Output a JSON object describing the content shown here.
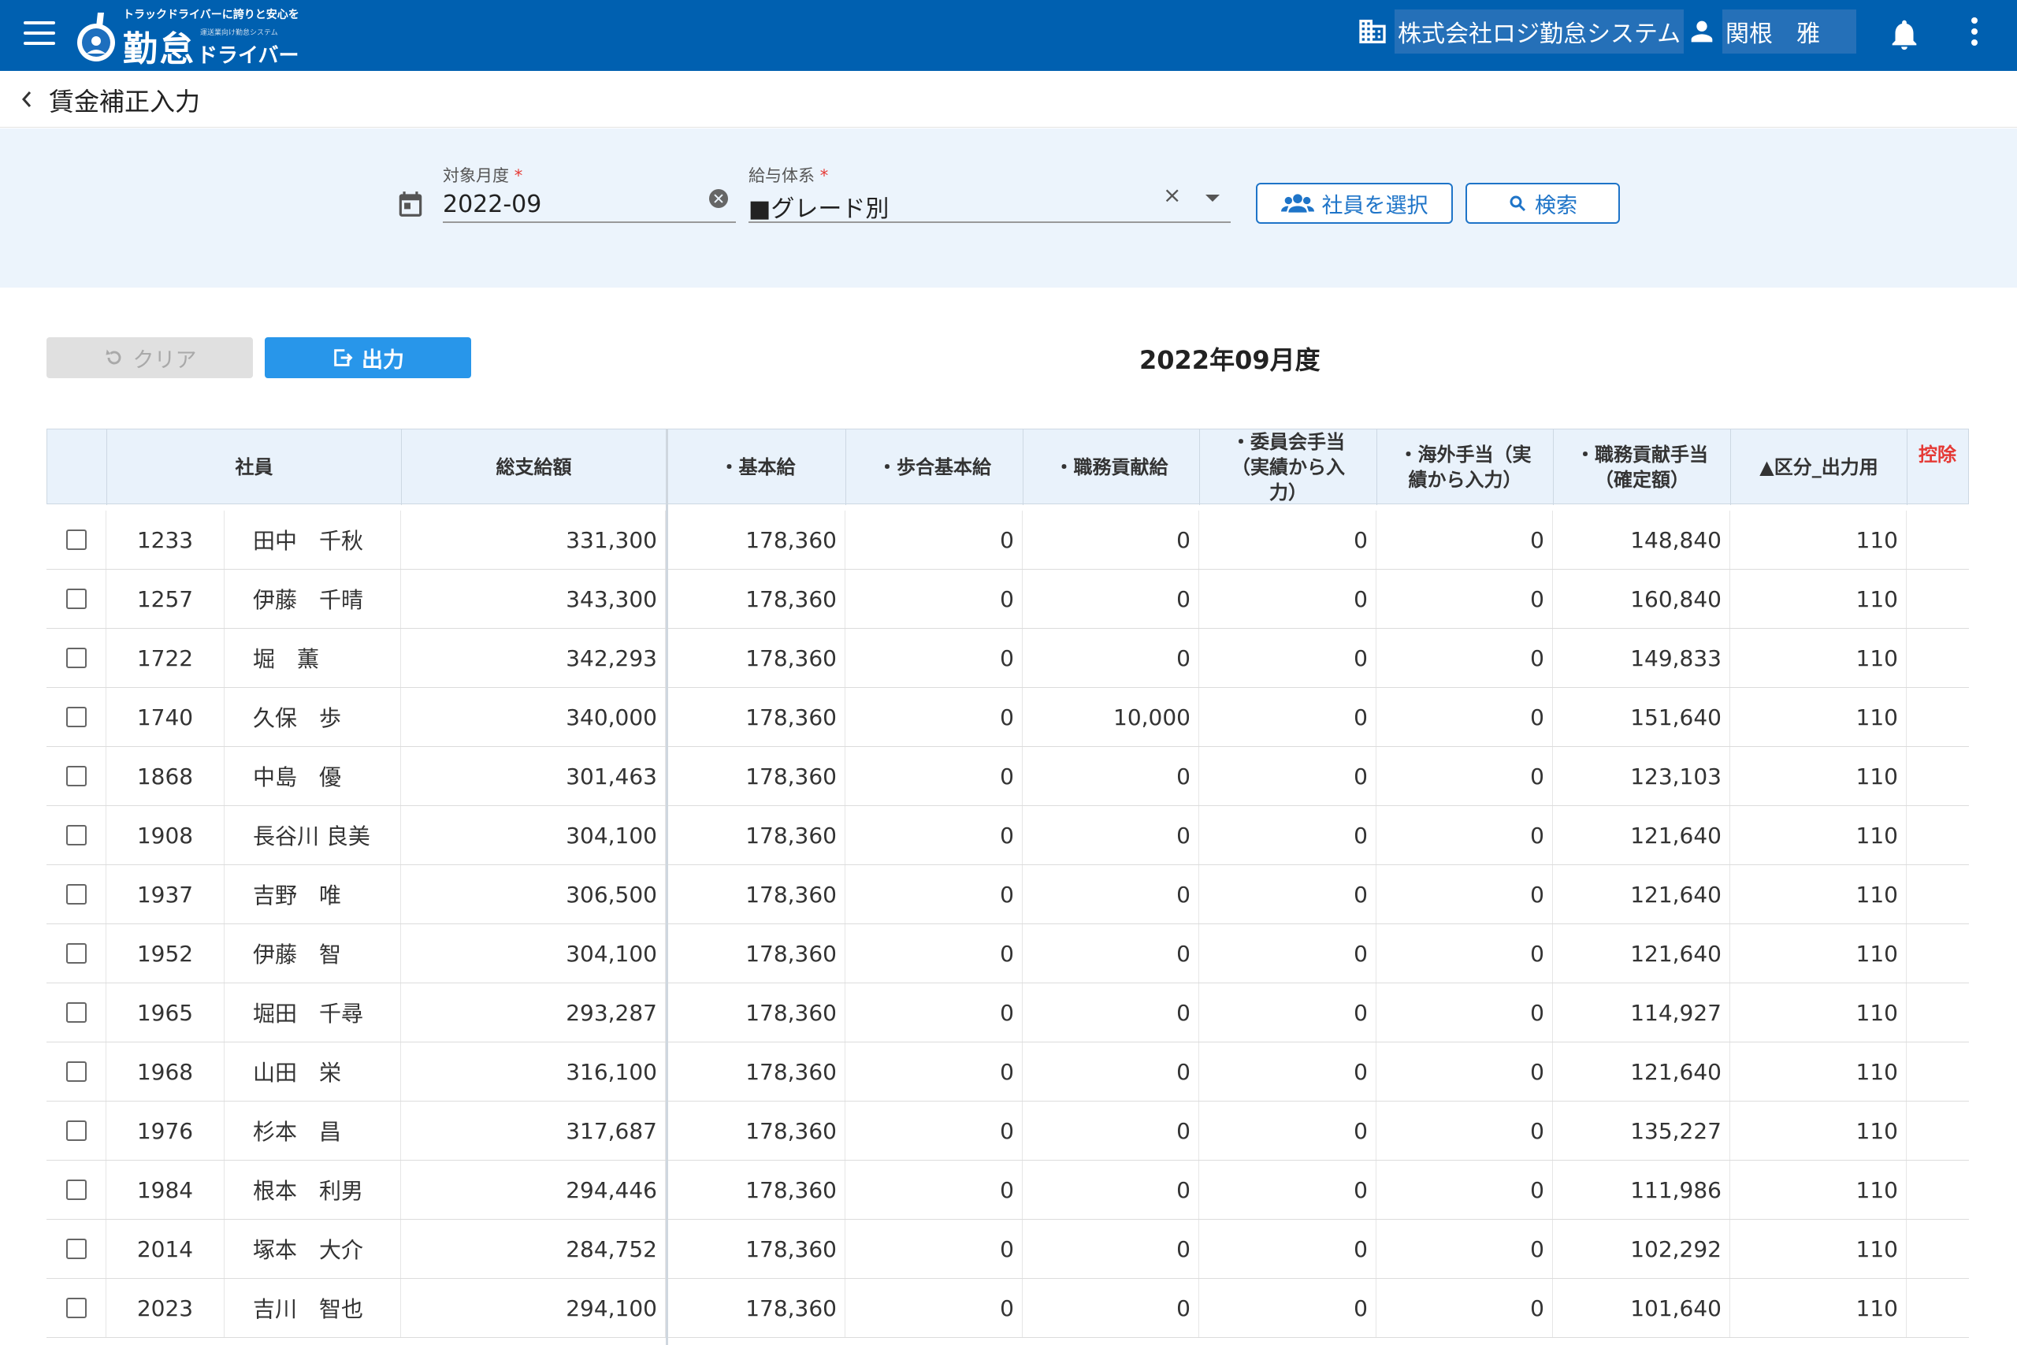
{
  "header": {
    "logo_tagline": "トラックドライバーに誇りと安心を",
    "logo_main": "勤怠",
    "logo_sub_small": "運送業向け勤怠システム",
    "logo_sub": "ドライバー",
    "company": "株式会社ロジ勤怠システム",
    "user": "関根　雅",
    "brand_color": "#0060b0"
  },
  "page": {
    "title": "賃金補正入力"
  },
  "filters": {
    "month_label": "対象月度",
    "month_value": "2022-09",
    "pay_label": "給与体系",
    "pay_value": "■グレード別",
    "required_mark": "*",
    "select_employee": "社員を選択",
    "search": "検索"
  },
  "actions": {
    "clear": "クリア",
    "output": "出力",
    "period": "2022年09月度"
  },
  "table": {
    "headers": {
      "employee": "社員",
      "total": "総支給額",
      "basic": "・基本給",
      "commission": "・歩合基本給",
      "duty": "・職務貢献給",
      "committee": "・委員会手当（実績から入力）",
      "overseas": "・海外手当（実績から入力）",
      "duty_allow": "・職務貢献手当（確定額）",
      "category": "▲区分_出力用",
      "deduction": "控除"
    },
    "rows": [
      {
        "id": "1233",
        "name": "田中　千秋",
        "total": "331,300",
        "basic": "178,360",
        "commission": "0",
        "duty": "0",
        "committee": "0",
        "overseas": "0",
        "duty_allow": "148,840",
        "category": "110"
      },
      {
        "id": "1257",
        "name": "伊藤　千晴",
        "total": "343,300",
        "basic": "178,360",
        "commission": "0",
        "duty": "0",
        "committee": "0",
        "overseas": "0",
        "duty_allow": "160,840",
        "category": "110"
      },
      {
        "id": "1722",
        "name": "堀　薫",
        "total": "342,293",
        "basic": "178,360",
        "commission": "0",
        "duty": "0",
        "committee": "0",
        "overseas": "0",
        "duty_allow": "149,833",
        "category": "110"
      },
      {
        "id": "1740",
        "name": "久保　歩",
        "total": "340,000",
        "basic": "178,360",
        "commission": "0",
        "duty": "10,000",
        "committee": "0",
        "overseas": "0",
        "duty_allow": "151,640",
        "category": "110"
      },
      {
        "id": "1868",
        "name": "中島　優",
        "total": "301,463",
        "basic": "178,360",
        "commission": "0",
        "duty": "0",
        "committee": "0",
        "overseas": "0",
        "duty_allow": "123,103",
        "category": "110"
      },
      {
        "id": "1908",
        "name": "長谷川 良美",
        "total": "304,100",
        "basic": "178,360",
        "commission": "0",
        "duty": "0",
        "committee": "0",
        "overseas": "0",
        "duty_allow": "121,640",
        "category": "110"
      },
      {
        "id": "1937",
        "name": "吉野　唯",
        "total": "306,500",
        "basic": "178,360",
        "commission": "0",
        "duty": "0",
        "committee": "0",
        "overseas": "0",
        "duty_allow": "121,640",
        "category": "110"
      },
      {
        "id": "1952",
        "name": "伊藤　智",
        "total": "304,100",
        "basic": "178,360",
        "commission": "0",
        "duty": "0",
        "committee": "0",
        "overseas": "0",
        "duty_allow": "121,640",
        "category": "110"
      },
      {
        "id": "1965",
        "name": "堀田　千尋",
        "total": "293,287",
        "basic": "178,360",
        "commission": "0",
        "duty": "0",
        "committee": "0",
        "overseas": "0",
        "duty_allow": "114,927",
        "category": "110"
      },
      {
        "id": "1968",
        "name": "山田　栄",
        "total": "316,100",
        "basic": "178,360",
        "commission": "0",
        "duty": "0",
        "committee": "0",
        "overseas": "0",
        "duty_allow": "121,640",
        "category": "110"
      },
      {
        "id": "1976",
        "name": "杉本　昌",
        "total": "317,687",
        "basic": "178,360",
        "commission": "0",
        "duty": "0",
        "committee": "0",
        "overseas": "0",
        "duty_allow": "135,227",
        "category": "110"
      },
      {
        "id": "1984",
        "name": "根本　利男",
        "total": "294,446",
        "basic": "178,360",
        "commission": "0",
        "duty": "0",
        "committee": "0",
        "overseas": "0",
        "duty_allow": "111,986",
        "category": "110"
      },
      {
        "id": "2014",
        "name": "塚本　大介",
        "total": "284,752",
        "basic": "178,360",
        "commission": "0",
        "duty": "0",
        "committee": "0",
        "overseas": "0",
        "duty_allow": "102,292",
        "category": "110"
      },
      {
        "id": "2023",
        "name": "吉川　智也",
        "total": "294,100",
        "basic": "178,360",
        "commission": "0",
        "duty": "0",
        "committee": "0",
        "overseas": "0",
        "duty_allow": "101,640",
        "category": "110"
      }
    ]
  }
}
